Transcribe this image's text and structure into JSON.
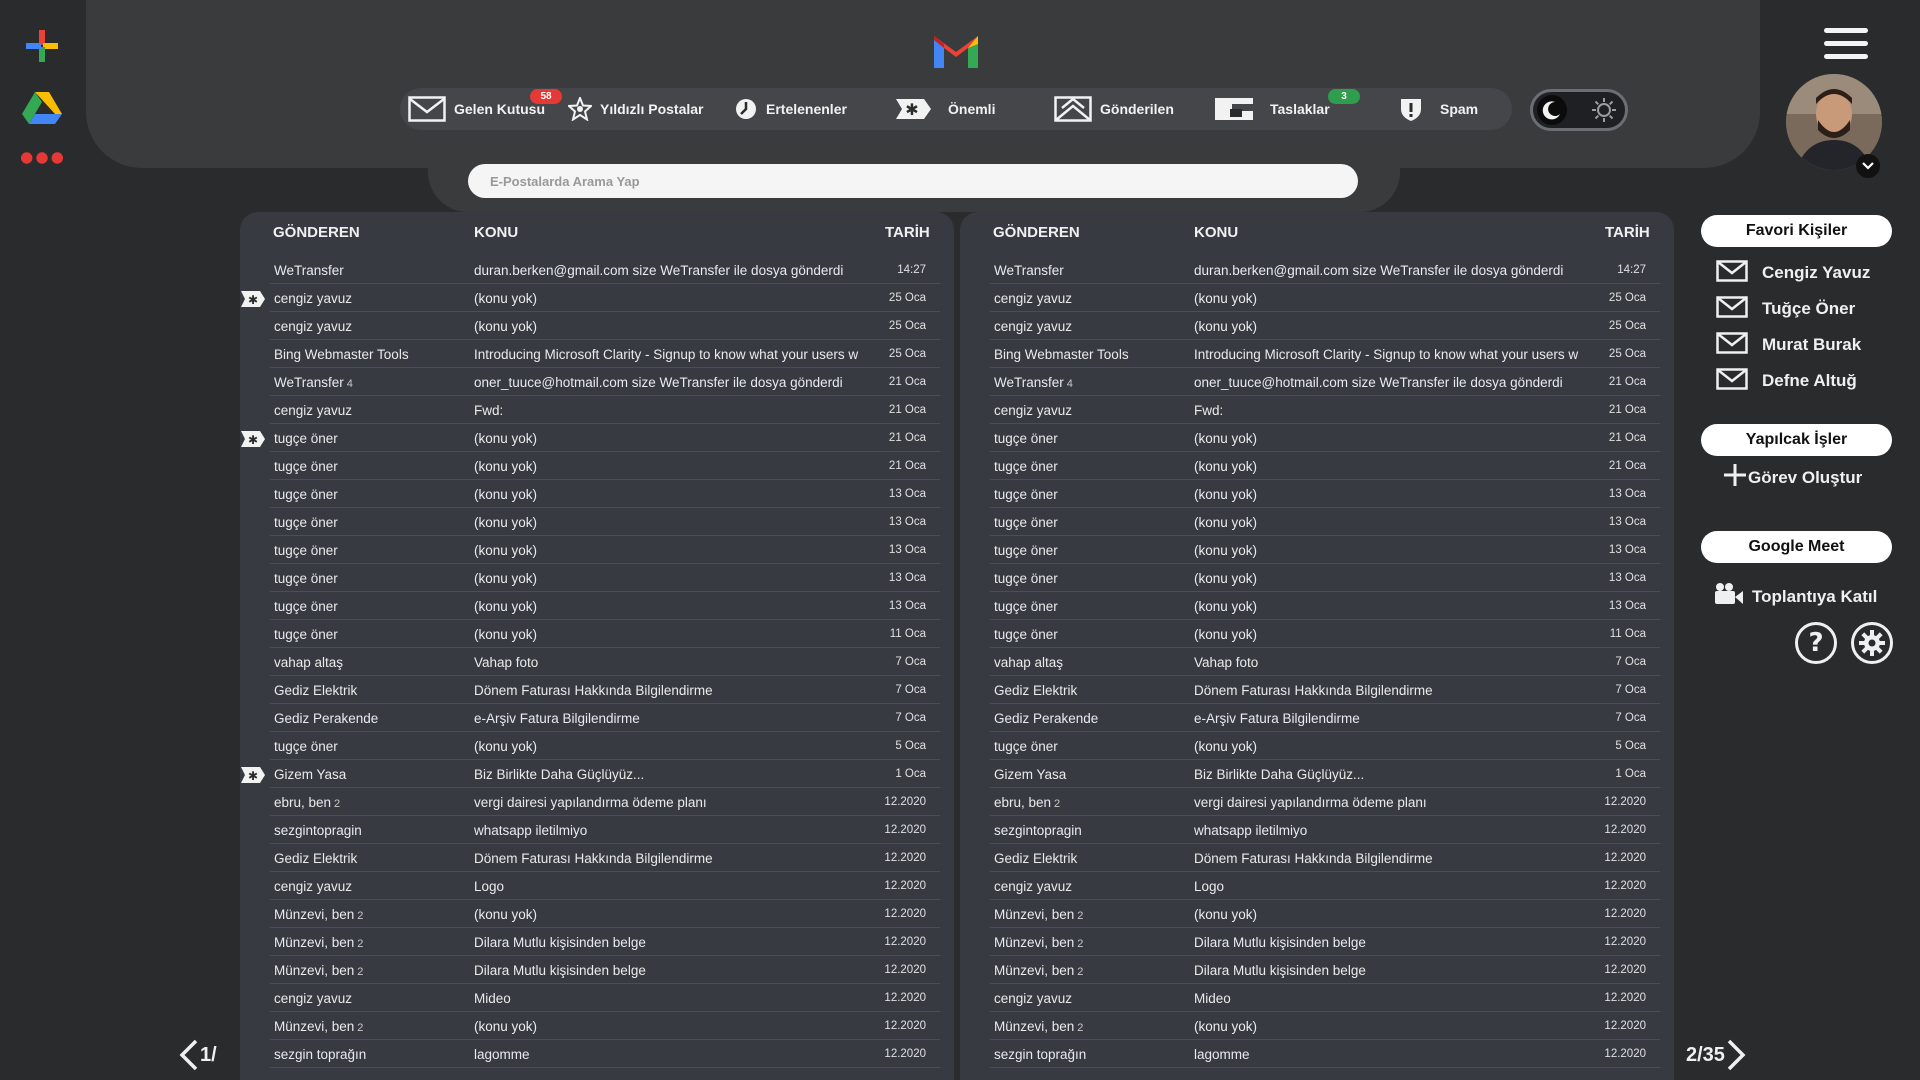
{
  "left_rail": {
    "items": [
      {
        "name": "add-icon",
        "colors": [
          "#ea4335",
          "#fbbc04",
          "#34a853",
          "#4285f4"
        ]
      },
      {
        "name": "google-drive-icon"
      },
      {
        "name": "more-apps-icon",
        "color": "#e53935"
      }
    ]
  },
  "nav": {
    "items": [
      {
        "label": "Gelen Kutusu",
        "badge": "58",
        "badge_color": "#e53935",
        "icon": "inbox-icon"
      },
      {
        "label": "Yıldızlı Postalar",
        "icon": "star-icon"
      },
      {
        "label": "Ertelenenler",
        "icon": "clock-icon"
      },
      {
        "label": "Önemli",
        "icon": "important-icon"
      },
      {
        "label": "Gönderilen",
        "icon": "sent-icon"
      },
      {
        "label": "Taslaklar",
        "badge": "3",
        "badge_color": "#2e9d4c",
        "icon": "drafts-icon"
      },
      {
        "label": "Spam",
        "icon": "spam-icon"
      }
    ]
  },
  "search": {
    "placeholder": "E-Postalarda Arama Yap"
  },
  "table": {
    "headers": {
      "sender": "GÖNDEREN",
      "subject": "KONU",
      "date": "TARİH"
    }
  },
  "emails": [
    {
      "sender": "WeTransfer",
      "count": "",
      "subject": "duran.berken@gmail.com size WeTransfer ile dosya gönderdi",
      "date": "14:27",
      "important": false
    },
    {
      "sender": "cengiz yavuz",
      "count": "",
      "subject": "(konu yok)",
      "date": "25 Oca",
      "important": true
    },
    {
      "sender": "cengiz yavuz",
      "count": "",
      "subject": "(konu yok)",
      "date": "25 Oca",
      "important": false
    },
    {
      "sender": "Bing Webmaster Tools",
      "count": "",
      "subject": "Introducing Microsoft Clarity - Signup to know what your users w",
      "date": "25 Oca",
      "important": false
    },
    {
      "sender": "WeTransfer",
      "count": "4",
      "subject": "oner_tuuce@hotmail.com size WeTransfer ile dosya gönderdi",
      "date": "21 Oca",
      "important": false
    },
    {
      "sender": "cengiz yavuz",
      "count": "",
      "subject": "Fwd:",
      "date": "21 Oca",
      "important": false
    },
    {
      "sender": "tugçe öner",
      "count": "",
      "subject": "(konu yok)",
      "date": "21 Oca",
      "important": true
    },
    {
      "sender": "tugçe öner",
      "count": "",
      "subject": "(konu yok)",
      "date": "21 Oca",
      "important": false
    },
    {
      "sender": "tugçe öner",
      "count": "",
      "subject": "(konu yok)",
      "date": "13 Oca",
      "important": false
    },
    {
      "sender": "tugçe öner",
      "count": "",
      "subject": "(konu yok)",
      "date": "13 Oca",
      "important": false
    },
    {
      "sender": "tugçe öner",
      "count": "",
      "subject": "(konu yok)",
      "date": "13 Oca",
      "important": false
    },
    {
      "sender": "tugçe öner",
      "count": "",
      "subject": "(konu yok)",
      "date": "13 Oca",
      "important": false
    },
    {
      "sender": "tugçe öner",
      "count": "",
      "subject": "(konu yok)",
      "date": "13 Oca",
      "important": false
    },
    {
      "sender": "tugçe öner",
      "count": "",
      "subject": "(konu yok)",
      "date": "11 Oca",
      "important": false
    },
    {
      "sender": "vahap altaş",
      "count": "",
      "subject": "Vahap foto",
      "date": "7 Oca",
      "important": false
    },
    {
      "sender": "Gediz Elektrik",
      "count": "",
      "subject": "Dönem Faturası Hakkında Bilgilendirme",
      "date": "7 Oca",
      "important": false
    },
    {
      "sender": "Gediz Perakende",
      "count": "",
      "subject": "e-Arşiv Fatura Bilgilendirme",
      "date": "7 Oca",
      "important": false
    },
    {
      "sender": "tugçe öner",
      "count": "",
      "subject": "(konu yok)",
      "date": "5 Oca",
      "important": false
    },
    {
      "sender": "Gizem Yasa",
      "count": "",
      "subject": "Biz Birlikte Daha Güçlüyüz...",
      "date": "1 Oca",
      "important": true
    },
    {
      "sender": "ebru, ben",
      "count": "2",
      "subject": "vergi dairesi yapılandırma ödeme planı",
      "date": "12.2020",
      "important": false
    },
    {
      "sender": "sezgintopragin",
      "count": "",
      "subject": "whatsapp iletilmiyo",
      "date": "12.2020",
      "important": false
    },
    {
      "sender": "Gediz Elektrik",
      "count": "",
      "subject": "Dönem Faturası Hakkında Bilgilendirme",
      "date": "12.2020",
      "important": false
    },
    {
      "sender": "cengiz yavuz",
      "count": "",
      "subject": "Logo",
      "date": "12.2020",
      "important": false
    },
    {
      "sender": "Münzevi, ben",
      "count": "2",
      "subject": "(konu yok)",
      "date": "12.2020",
      "important": false
    },
    {
      "sender": "Münzevi, ben",
      "count": "2",
      "subject": "Dilara Mutlu kişisinden belge",
      "date": "12.2020",
      "important": false
    },
    {
      "sender": "Münzevi, ben",
      "count": "2",
      "subject": "Dilara Mutlu kişisinden belge",
      "date": "12.2020",
      "important": false
    },
    {
      "sender": "cengiz yavuz",
      "count": "",
      "subject": "Mideo",
      "date": "12.2020",
      "important": false
    },
    {
      "sender": "Münzevi, ben",
      "count": "2",
      "subject": "(konu yok)",
      "date": "12.2020",
      "important": false
    },
    {
      "sender": "sezgin toprağın",
      "count": "",
      "subject": "lagomme",
      "date": "12.2020",
      "important": false
    }
  ],
  "sidebar": {
    "favorites_title": "Favori Kişiler",
    "contacts": [
      "Cengiz Yavuz",
      "Tuğçe Öner",
      "Murat Burak",
      "Defne Altuğ"
    ],
    "tasks_title": "Yapılcak İşler",
    "create_task": "Görev Oluştur",
    "meet_title": "Google Meet",
    "join_meeting": "Toplantıya Katıl"
  },
  "pagination": {
    "left_text": "1/",
    "right_text": "2/35"
  }
}
